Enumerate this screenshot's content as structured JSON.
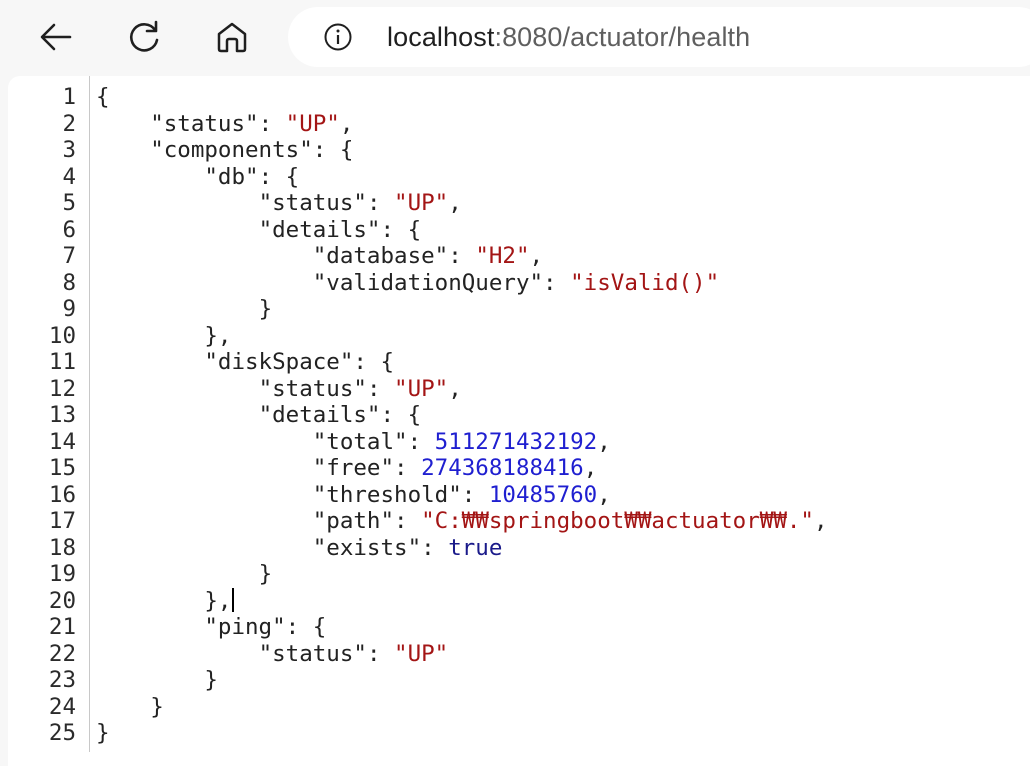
{
  "browser": {
    "url_host": "localhost",
    "url_path": ":8080/actuator/health"
  },
  "json_viewer": {
    "lines": [
      {
        "n": "1",
        "indent": 0,
        "tokens": [
          {
            "t": "p",
            "v": "{"
          }
        ]
      },
      {
        "n": "2",
        "indent": 1,
        "tokens": [
          {
            "t": "k",
            "v": "\"status\""
          },
          {
            "t": "p",
            "v": ": "
          },
          {
            "t": "s",
            "v": "\"UP\""
          },
          {
            "t": "p",
            "v": ","
          }
        ]
      },
      {
        "n": "3",
        "indent": 1,
        "tokens": [
          {
            "t": "k",
            "v": "\"components\""
          },
          {
            "t": "p",
            "v": ": {"
          }
        ]
      },
      {
        "n": "4",
        "indent": 2,
        "tokens": [
          {
            "t": "k",
            "v": "\"db\""
          },
          {
            "t": "p",
            "v": ": {"
          }
        ]
      },
      {
        "n": "5",
        "indent": 3,
        "tokens": [
          {
            "t": "k",
            "v": "\"status\""
          },
          {
            "t": "p",
            "v": ": "
          },
          {
            "t": "s",
            "v": "\"UP\""
          },
          {
            "t": "p",
            "v": ","
          }
        ]
      },
      {
        "n": "6",
        "indent": 3,
        "tokens": [
          {
            "t": "k",
            "v": "\"details\""
          },
          {
            "t": "p",
            "v": ": {"
          }
        ]
      },
      {
        "n": "7",
        "indent": 4,
        "tokens": [
          {
            "t": "k",
            "v": "\"database\""
          },
          {
            "t": "p",
            "v": ": "
          },
          {
            "t": "s",
            "v": "\"H2\""
          },
          {
            "t": "p",
            "v": ","
          }
        ]
      },
      {
        "n": "8",
        "indent": 4,
        "tokens": [
          {
            "t": "k",
            "v": "\"validationQuery\""
          },
          {
            "t": "p",
            "v": ": "
          },
          {
            "t": "s",
            "v": "\"isValid()\""
          }
        ]
      },
      {
        "n": "9",
        "indent": 3,
        "tokens": [
          {
            "t": "p",
            "v": "}"
          }
        ]
      },
      {
        "n": "10",
        "indent": 2,
        "tokens": [
          {
            "t": "p",
            "v": "},"
          }
        ]
      },
      {
        "n": "11",
        "indent": 2,
        "tokens": [
          {
            "t": "k",
            "v": "\"diskSpace\""
          },
          {
            "t": "p",
            "v": ": {"
          }
        ]
      },
      {
        "n": "12",
        "indent": 3,
        "tokens": [
          {
            "t": "k",
            "v": "\"status\""
          },
          {
            "t": "p",
            "v": ": "
          },
          {
            "t": "s",
            "v": "\"UP\""
          },
          {
            "t": "p",
            "v": ","
          }
        ]
      },
      {
        "n": "13",
        "indent": 3,
        "tokens": [
          {
            "t": "k",
            "v": "\"details\""
          },
          {
            "t": "p",
            "v": ": {"
          }
        ]
      },
      {
        "n": "14",
        "indent": 4,
        "tokens": [
          {
            "t": "k",
            "v": "\"total\""
          },
          {
            "t": "p",
            "v": ": "
          },
          {
            "t": "n",
            "v": "511271432192"
          },
          {
            "t": "p",
            "v": ","
          }
        ]
      },
      {
        "n": "15",
        "indent": 4,
        "tokens": [
          {
            "t": "k",
            "v": "\"free\""
          },
          {
            "t": "p",
            "v": ": "
          },
          {
            "t": "n",
            "v": "274368188416"
          },
          {
            "t": "p",
            "v": ","
          }
        ]
      },
      {
        "n": "16",
        "indent": 4,
        "tokens": [
          {
            "t": "k",
            "v": "\"threshold\""
          },
          {
            "t": "p",
            "v": ": "
          },
          {
            "t": "n",
            "v": "10485760"
          },
          {
            "t": "p",
            "v": ","
          }
        ]
      },
      {
        "n": "17",
        "indent": 4,
        "tokens": [
          {
            "t": "k",
            "v": "\"path\""
          },
          {
            "t": "p",
            "v": ": "
          },
          {
            "t": "s",
            "v": "\"C:₩₩springboot₩₩actuator₩₩.\""
          },
          {
            "t": "p",
            "v": ","
          }
        ]
      },
      {
        "n": "18",
        "indent": 4,
        "tokens": [
          {
            "t": "k",
            "v": "\"exists\""
          },
          {
            "t": "p",
            "v": ": "
          },
          {
            "t": "b",
            "v": "true"
          }
        ]
      },
      {
        "n": "19",
        "indent": 3,
        "tokens": [
          {
            "t": "p",
            "v": "}"
          }
        ]
      },
      {
        "n": "20",
        "indent": 2,
        "tokens": [
          {
            "t": "p",
            "v": "},"
          }
        ],
        "caret": true
      },
      {
        "n": "21",
        "indent": 2,
        "tokens": [
          {
            "t": "k",
            "v": "\"ping\""
          },
          {
            "t": "p",
            "v": ": {"
          }
        ]
      },
      {
        "n": "22",
        "indent": 3,
        "tokens": [
          {
            "t": "k",
            "v": "\"status\""
          },
          {
            "t": "p",
            "v": ": "
          },
          {
            "t": "s",
            "v": "\"UP\""
          }
        ]
      },
      {
        "n": "23",
        "indent": 2,
        "tokens": [
          {
            "t": "p",
            "v": "}"
          }
        ]
      },
      {
        "n": "24",
        "indent": 1,
        "tokens": [
          {
            "t": "p",
            "v": "}"
          }
        ]
      },
      {
        "n": "25",
        "indent": 0,
        "tokens": [
          {
            "t": "p",
            "v": "}"
          }
        ]
      }
    ]
  },
  "icons": {
    "back": "arrow-left-icon",
    "reload": "reload-icon",
    "home": "home-icon",
    "info": "info-icon"
  }
}
